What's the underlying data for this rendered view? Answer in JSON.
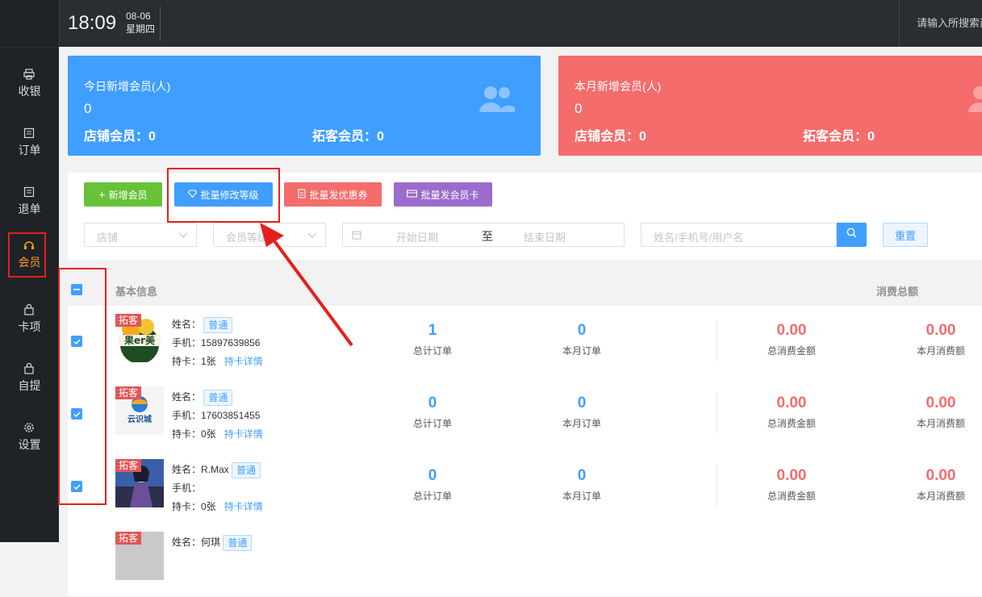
{
  "topbar": {
    "time": "18:09",
    "date": "08-06",
    "weekday": "星期四",
    "search_placeholder": "请输入所搜索商"
  },
  "sidebar": {
    "items": [
      {
        "label": "收银",
        "icon": "printer-icon"
      },
      {
        "label": "订单",
        "icon": "list-icon"
      },
      {
        "label": "退单",
        "icon": "list-icon"
      },
      {
        "label": "会员",
        "icon": "headset-icon",
        "active": true
      },
      {
        "label": "卡项",
        "icon": "bag-icon"
      },
      {
        "label": "自提",
        "icon": "bag-icon"
      },
      {
        "label": "设置",
        "icon": "gear-icon"
      }
    ]
  },
  "stats": {
    "today": {
      "title": "今日新增会员(人)",
      "value": "0",
      "store_label": "店铺会员：0",
      "expand_label": "拓客会员：0"
    },
    "month": {
      "title": "本月新增会员(人)",
      "value": "0",
      "store_label": "店铺会员：0",
      "expand_label": "拓客会员：0"
    }
  },
  "toolbar": {
    "add_member": "新增会员",
    "batch_level": "批量修改等级",
    "batch_coupon": "批量发优惠券",
    "batch_card": "批量发会员卡"
  },
  "filters": {
    "store_placeholder": "店铺",
    "level_placeholder": "会员等级",
    "start_date": "开始日期",
    "to": "至",
    "end_date": "结束日期",
    "search_placeholder": "姓名/手机号/用户名",
    "reset": "重置"
  },
  "table": {
    "col_basic": "基本信息",
    "col_total": "消费总额",
    "label_total_orders": "总计订单",
    "label_month_orders": "本月订单",
    "label_total_spent": "总消费金额",
    "label_month_spent": "本月消费额",
    "rows": [
      {
        "tag": "拓客",
        "name": "姓名：",
        "level": "普通",
        "phone": "手机：15897639856",
        "cards": "持卡：1张",
        "card_link": "持卡详情",
        "total_orders": "1",
        "month_orders": "0",
        "total_spent": "0.00",
        "month_spent": "0.00"
      },
      {
        "tag": "拓客",
        "name": "姓名：",
        "level": "普通",
        "phone": "手机：17603851455",
        "cards": "持卡：0张",
        "card_link": "持卡详情",
        "total_orders": "0",
        "month_orders": "0",
        "total_spent": "0.00",
        "month_spent": "0.00"
      },
      {
        "tag": "拓客",
        "name": "姓名：R.Max",
        "level": "普通",
        "phone": "手机：",
        "cards": "持卡：0张",
        "card_link": "持卡详情",
        "total_orders": "0",
        "month_orders": "0",
        "total_spent": "0.00",
        "month_spent": "0.00"
      },
      {
        "tag": "拓客",
        "name": "姓名：何琪",
        "level": "普通"
      }
    ]
  },
  "colors": {
    "primary": "#409eff",
    "danger": "#f56c6c",
    "success": "#67c23a",
    "purple": "#9b6ccc",
    "annotation": "#e5201b"
  }
}
